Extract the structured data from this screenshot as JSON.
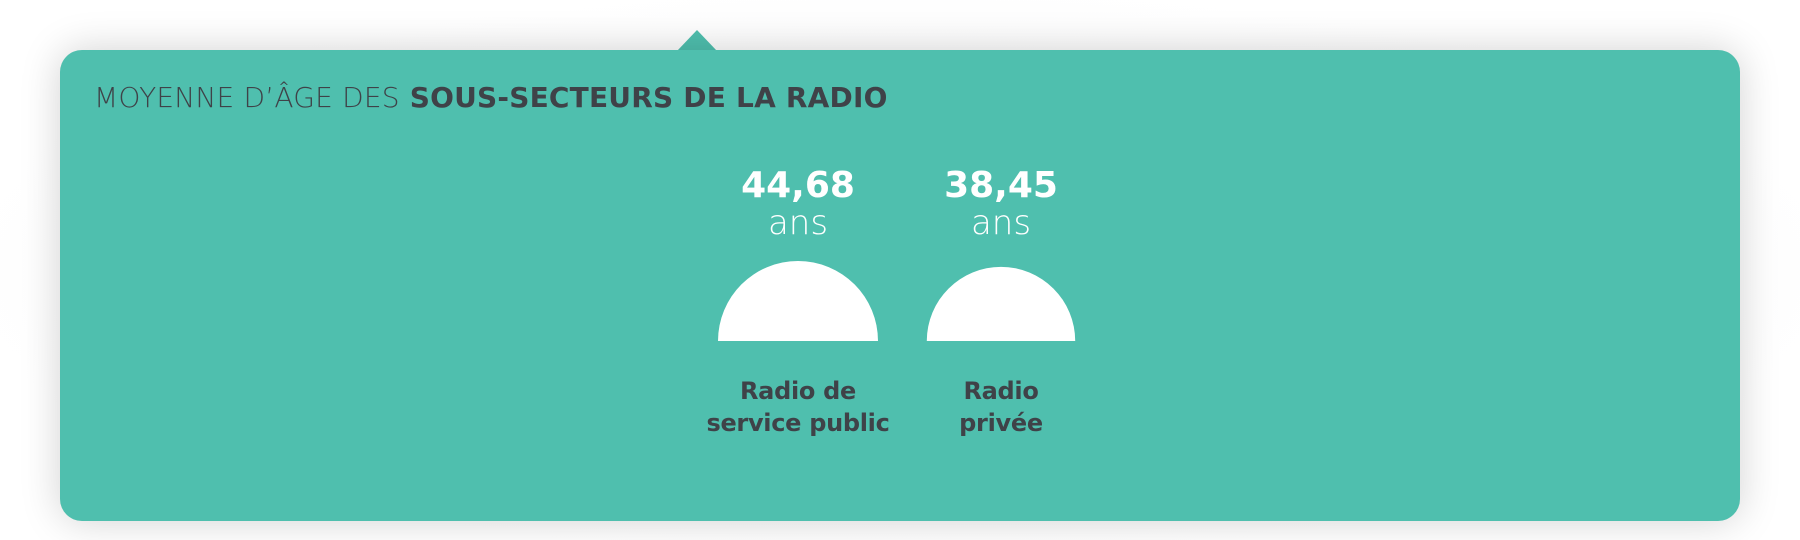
{
  "colors": {
    "card_background": "#4fbfae",
    "shape_fill": "#ffffff",
    "value_text": "#ffffff",
    "title_text": "#3f4248",
    "label_text": "#3f4248"
  },
  "title": {
    "light": "MOYENNE D’ÂGE DES",
    "bold": "SOUS-SECTEURS DE LA RADIO"
  },
  "chart_data": {
    "type": "bar",
    "title": "MOYENNE D’ÂGE DES SOUS-SECTEURS DE LA RADIO",
    "categories": [
      "Radio de service public",
      "Radio privée"
    ],
    "category_lines": [
      [
        "Radio de",
        "service public"
      ],
      [
        "Radio",
        "privée"
      ]
    ],
    "values": [
      44.68,
      38.45
    ],
    "value_labels": [
      "44,68",
      "38,45"
    ],
    "unit": "ans",
    "marker": "semicircle"
  }
}
